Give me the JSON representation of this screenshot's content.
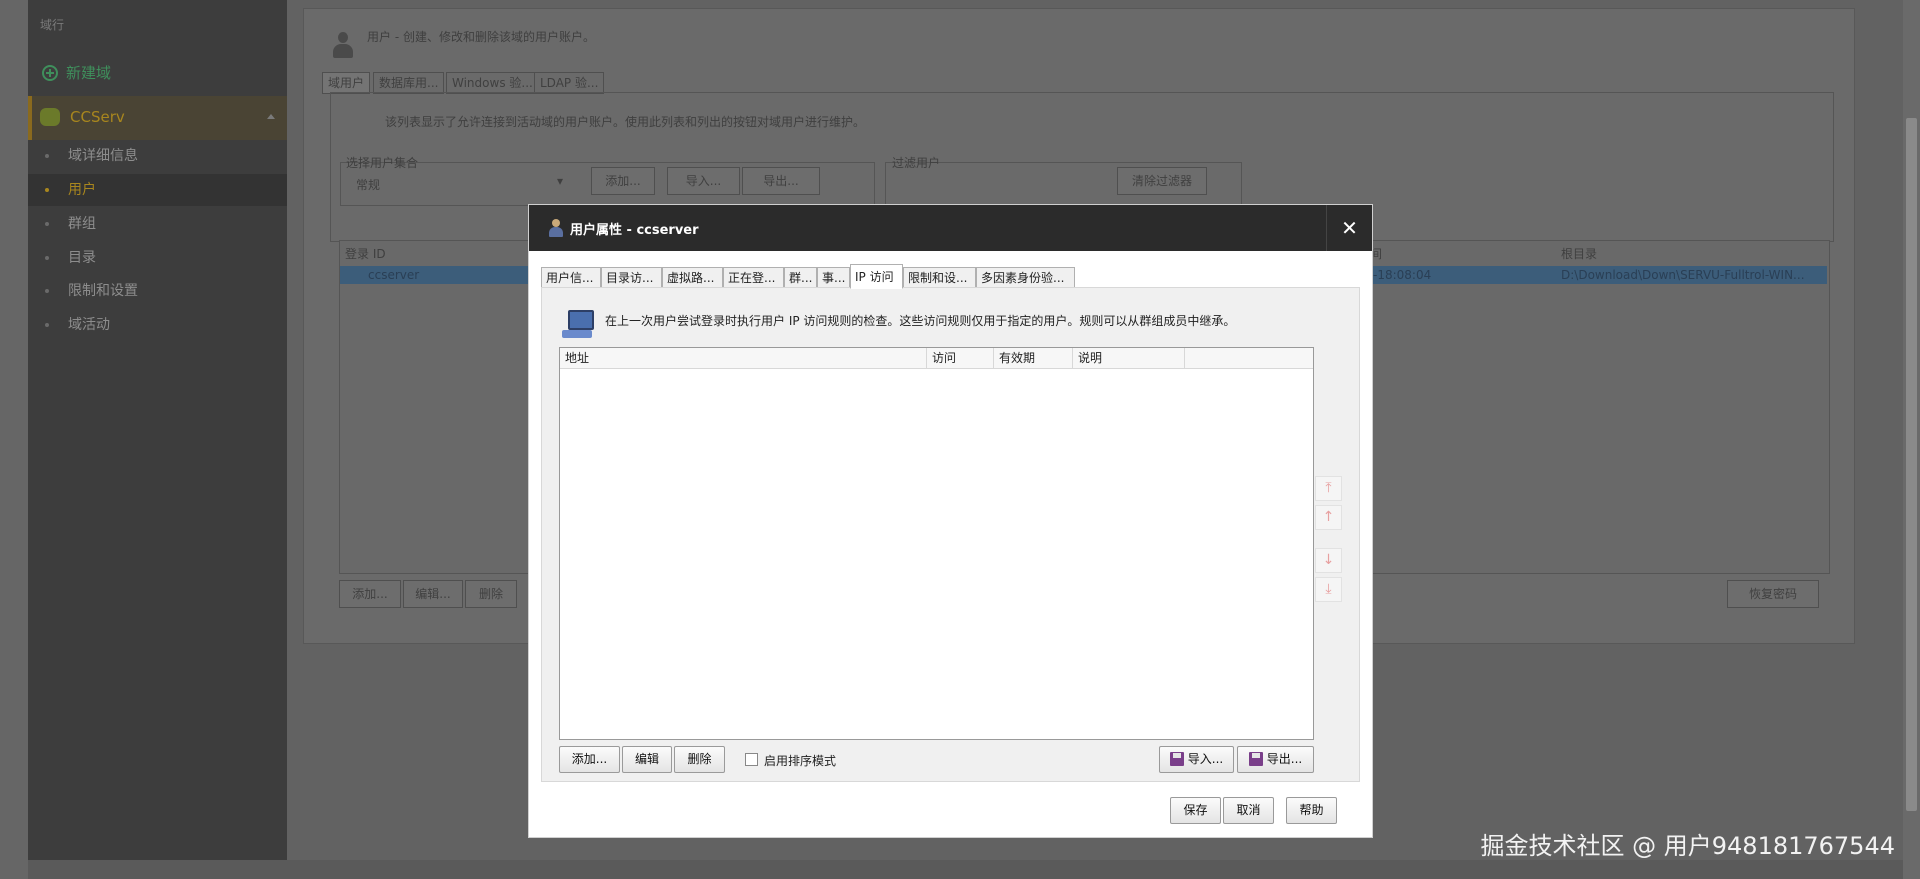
{
  "background": {
    "crumb": "域行",
    "new_domain": "新建域",
    "server_name": "CCServ",
    "nav_items": [
      "域详细信息",
      "用户",
      "群组",
      "目录",
      "限制和设置",
      "域活动"
    ],
    "header_text": "用户 - 创建、修改和删除该域的用户账户。",
    "tabs": [
      "域用户",
      "数据库用...",
      "Windows 验...",
      "LDAP 验..."
    ],
    "list_desc": "该列表显示了允许连接到活动域的用户账户。使用此列表和列出的按钮对域用户进行维护。",
    "select_group_label": "选择用户集合",
    "select_value": "常规",
    "btn_add": "添加...",
    "btn_import": "导入...",
    "btn_export": "导出...",
    "filter_label": "过滤用户",
    "btn_clear_filter": "清除过滤器",
    "col_login_id": "登录 ID",
    "col_time": "间",
    "col_home_dir": "根目录",
    "row_login": "ccserver",
    "row_time": "-18:08:04",
    "row_home": "D:\\Download\\Down\\SERVU-Fulltrol-WIN...",
    "btn_add2": "添加...",
    "btn_edit": "编辑...",
    "btn_delete": "删除",
    "btn_recover": "恢复密码"
  },
  "dialog": {
    "title": "用户属性 - ccserver",
    "close_symbol": "✕",
    "tabs": [
      "用户信...",
      "目录访...",
      "虚拟路...",
      "正在登...",
      "群...",
      "事...",
      "IP 访问",
      "限制和设...",
      "多因素身份验..."
    ],
    "active_tab": "IP 访问",
    "description": "在上一次用户尝试登录时执行用户 IP 访问规则的检查。这些访问规则仅用于指定的用户。规则可以从群组成员中继承。",
    "columns": [
      "地址",
      "访问",
      "有效期",
      "说明"
    ],
    "rows": [],
    "arrows": [
      "⤒",
      "↑",
      "↓",
      "⤓"
    ],
    "buttons": {
      "add": "添加...",
      "edit": "编辑",
      "delete": "删除",
      "sort_mode": "启用排序模式",
      "import": "导入...",
      "export": "导出...",
      "save": "保存",
      "cancel": "取消",
      "help": "帮助"
    },
    "sort_mode_checked": false
  },
  "watermark": "掘金技术社区 @ 用户948181767544"
}
